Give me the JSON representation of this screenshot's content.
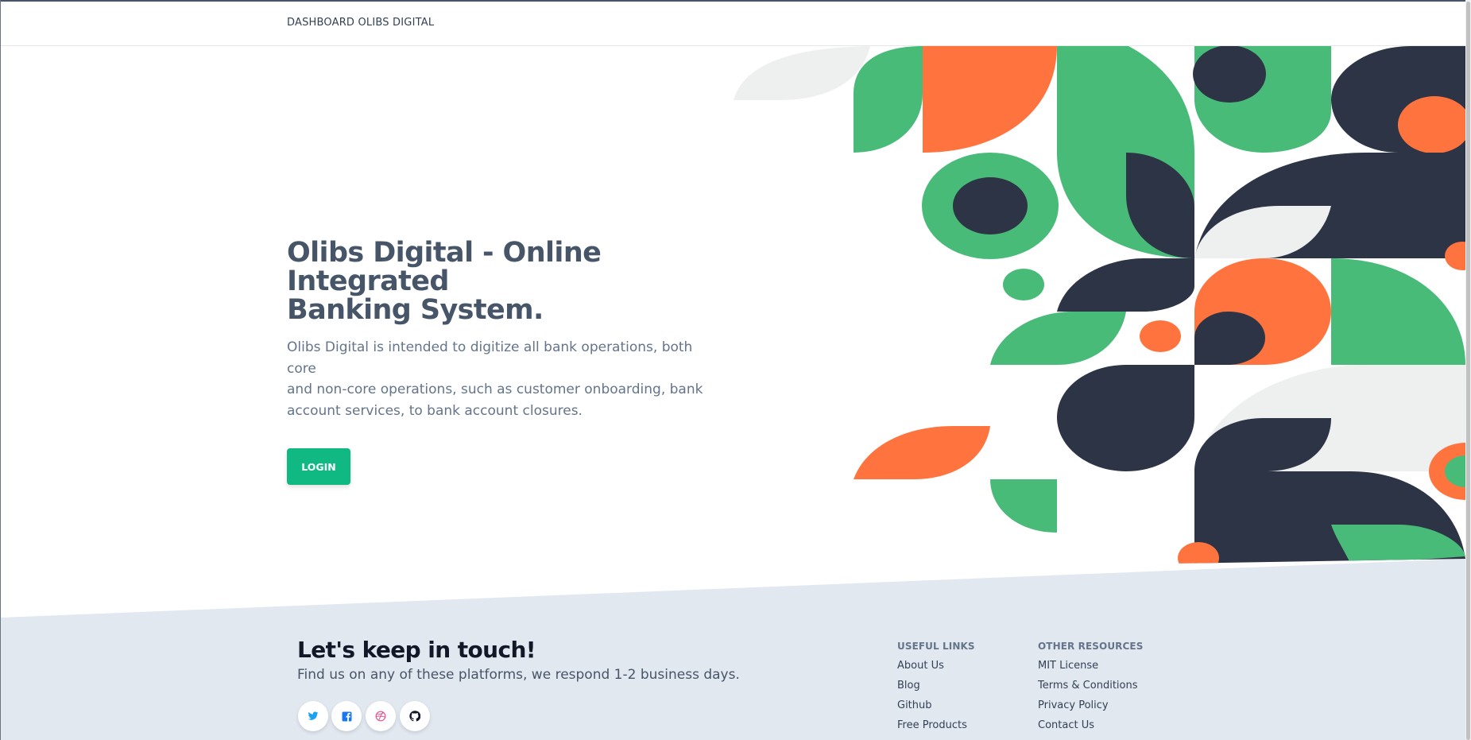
{
  "navbar": {
    "brand": "DASHBOARD OLIBS DIGITAL"
  },
  "hero": {
    "title_line1": "Olibs Digital - Online Integrated",
    "title_line2": "Banking System.",
    "description_line1": "Olibs Digital is intended to digitize all bank operations, both core",
    "description_line2": "and non-core operations, such as customer onboarding, bank",
    "description_line3": "account services, to bank account closures.",
    "login_label": "LOGIN"
  },
  "footer": {
    "title": "Let's keep in touch!",
    "subtitle": "Find us on any of these platforms, we respond 1-2 business days.",
    "social": [
      {
        "icon": "twitter-icon",
        "color": "#1da1f2"
      },
      {
        "icon": "facebook-icon",
        "color": "#1877f2"
      },
      {
        "icon": "dribbble-icon",
        "color": "#ea4c89"
      },
      {
        "icon": "github-icon",
        "color": "#111827"
      }
    ],
    "useful_links": {
      "heading": "USEFUL LINKS",
      "items": [
        "About Us",
        "Blog",
        "Github",
        "Free Products"
      ]
    },
    "other_resources": {
      "heading": "OTHER RESOURCES",
      "items": [
        "MIT License",
        "Terms & Conditions",
        "Privacy Policy",
        "Contact Us"
      ]
    }
  },
  "colors": {
    "accent": "#10b981",
    "green": "#48bb78",
    "orange": "#ff743e",
    "navy": "#2d3445",
    "light_gray": "#eeefef",
    "footer_bg": "#e2e8f0"
  }
}
